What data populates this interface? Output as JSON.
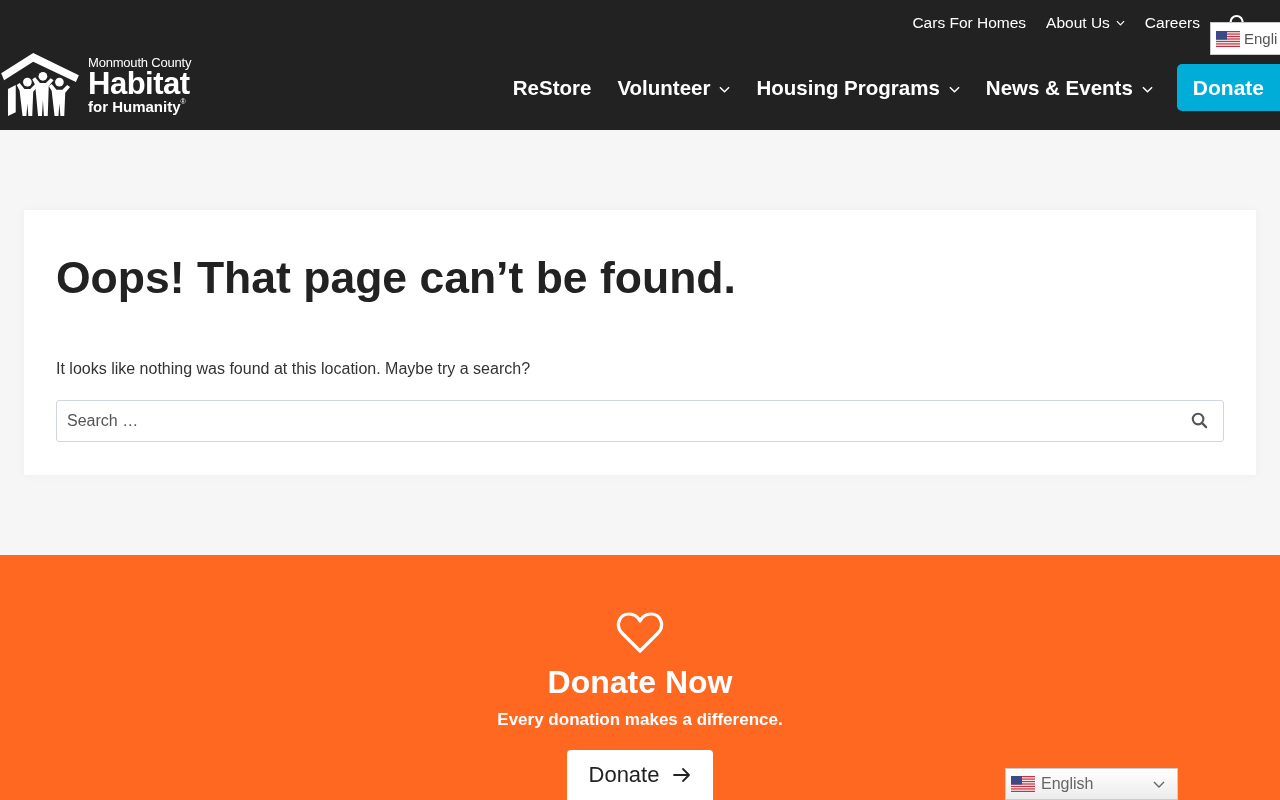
{
  "header": {
    "logo": {
      "line_1": "Monmouth County",
      "line_2": "Habitat",
      "line_3": "for Humanity$^{®}$"
    },
    "utility_nav": [
      {
        "label": "Cars For Homes",
        "has_submenu": false
      },
      {
        "label": "About Us",
        "has_submenu": true
      },
      {
        "label": "Careers",
        "has_submenu": false
      }
    ],
    "main_nav": [
      {
        "label": "ReStore",
        "has_submenu": false
      },
      {
        "label": "Volunteer",
        "has_submenu": true
      },
      {
        "label": "Housing Programs",
        "has_submenu": true
      },
      {
        "label": "News & Events",
        "has_submenu": true
      }
    ],
    "donate_button": {
      "label": "Donate"
    },
    "language_selector": {
      "label": "Engli"
    }
  },
  "error_card": {
    "title": "Oops! That page can’t be found.",
    "message": "It looks like nothing was found at this location. Maybe try a search?",
    "search": {
      "placeholder": "Search …"
    }
  },
  "donate_banner": {
    "title": "Donate Now",
    "subtitle": "Every donation makes a difference.",
    "button": {
      "label": "Donate"
    }
  },
  "language_selector": {
    "label": "English"
  }
}
